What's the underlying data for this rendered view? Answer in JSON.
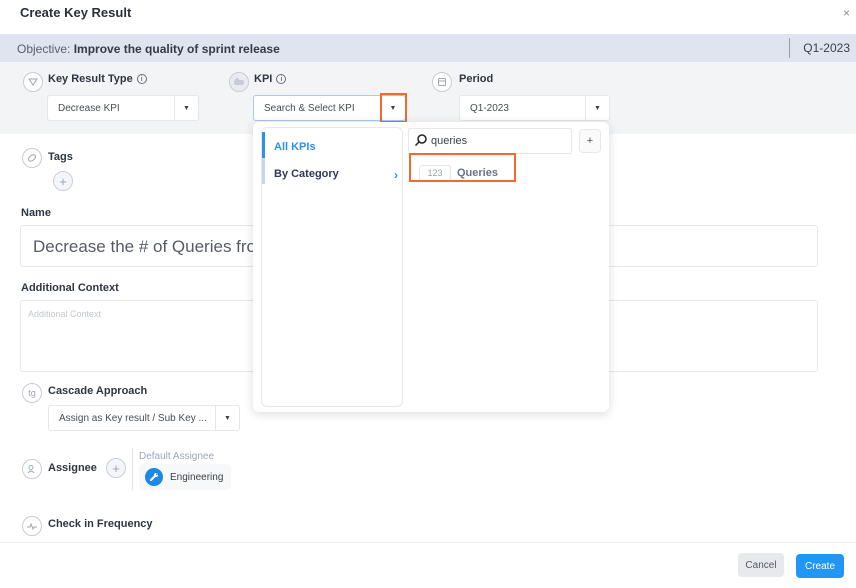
{
  "dialog": {
    "title": "Create Key Result",
    "close_icon": "×"
  },
  "objective": {
    "label": "Objective: ",
    "value": "Improve the quality of sprint release",
    "period": "Q1-2023"
  },
  "key_result_type": {
    "label": "Key Result Type",
    "info_icon": "i",
    "value": "Decrease KPI"
  },
  "kpi": {
    "label": "KPI",
    "info_icon": "i",
    "placeholder": "Search & Select KPI"
  },
  "period": {
    "label": "Period",
    "value": "Q1-2023"
  },
  "kpi_dropdown": {
    "categories": [
      {
        "label": "All KPIs",
        "active": true
      },
      {
        "label": "By Category",
        "active": false
      }
    ],
    "chevron": "›",
    "search_value": "queries",
    "add_icon": "+",
    "results": [
      {
        "type_badge": "123",
        "name": "Queries"
      }
    ]
  },
  "tags": {
    "label": "Tags",
    "add_icon": "+"
  },
  "name": {
    "label": "Name",
    "value": "Decrease the # of Queries from"
  },
  "additional_context": {
    "label": "Additional Context",
    "placeholder": "Additional Context"
  },
  "cascade": {
    "label": "Cascade Approach",
    "value": "Assign as Key result / Sub Key ..."
  },
  "assignee": {
    "label": "Assignee",
    "add_icon": "+",
    "default_title": "Default Assignee",
    "default_value": "Engineering"
  },
  "check_in": {
    "label": "Check in Frequency"
  },
  "footer": {
    "cancel_label": "Cancel",
    "create_label": "Create"
  },
  "colors": {
    "accent": "#2196f3",
    "highlight": "#f26a2e",
    "objective_bar": "#dfe4ee"
  }
}
